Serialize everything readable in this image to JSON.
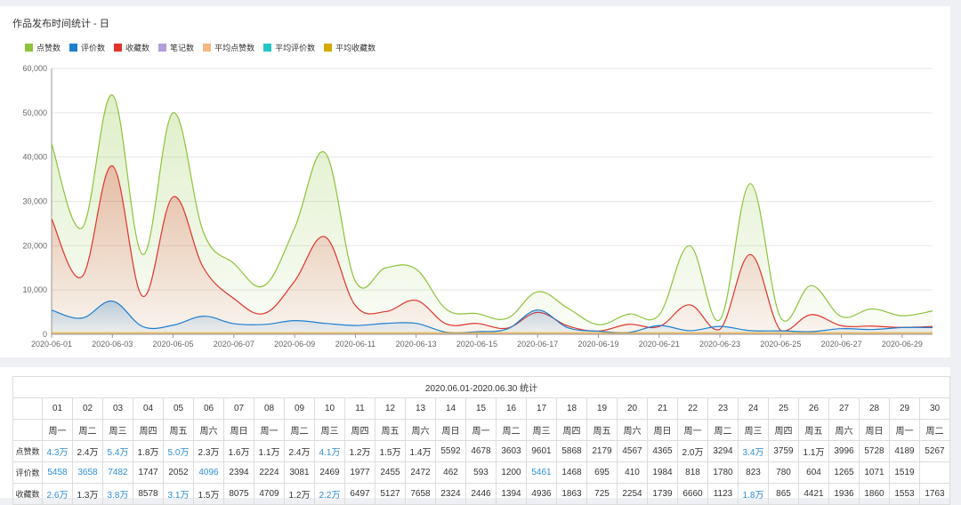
{
  "chart_data": {
    "type": "area",
    "title": "作品发布时间统计 - 日",
    "ylim": [
      0,
      60000
    ],
    "yticks": [
      "0",
      "10,000",
      "20,000",
      "30,000",
      "40,000",
      "50,000",
      "60,000"
    ],
    "ytick_values": [
      0,
      10000,
      20000,
      30000,
      40000,
      50000,
      60000
    ],
    "x": [
      "2020-06-01",
      "2020-06-02",
      "2020-06-03",
      "2020-06-04",
      "2020-06-05",
      "2020-06-06",
      "2020-06-07",
      "2020-06-08",
      "2020-06-09",
      "2020-06-10",
      "2020-06-11",
      "2020-06-12",
      "2020-06-13",
      "2020-06-14",
      "2020-06-15",
      "2020-06-16",
      "2020-06-17",
      "2020-06-18",
      "2020-06-19",
      "2020-06-20",
      "2020-06-21",
      "2020-06-22",
      "2020-06-23",
      "2020-06-24",
      "2020-06-25",
      "2020-06-26",
      "2020-06-27",
      "2020-06-28",
      "2020-06-29",
      "2020-06-30"
    ],
    "xtick_labels": [
      "2020-06-01",
      "2020-06-03",
      "2020-06-05",
      "2020-06-07",
      "2020-06-09",
      "2020-06-11",
      "2020-06-13",
      "2020-06-15",
      "2020-06-17",
      "2020-06-19",
      "2020-06-21",
      "2020-06-23",
      "2020-06-25",
      "2020-06-27",
      "2020-06-29"
    ],
    "grid": true,
    "legend_position": "top-left",
    "series": [
      {
        "name": "点赞数",
        "color": "#8cc43a",
        "values": [
          43000,
          24000,
          54000,
          18000,
          50000,
          23000,
          16000,
          11000,
          24000,
          41000,
          12000,
          15000,
          14700,
          5592,
          4678,
          3603,
          9601,
          5868,
          2179,
          4567,
          4365,
          20000,
          3294,
          34000,
          3759,
          11000,
          3996,
          5728,
          4189,
          5267
        ]
      },
      {
        "name": "评价数",
        "color": "#1f7fcf",
        "values": [
          5458,
          3658,
          7482,
          1747,
          2052,
          4096,
          2394,
          2224,
          3081,
          2469,
          1977,
          2455,
          2472,
          462,
          593,
          1200,
          5461,
          1468,
          695,
          410,
          1984,
          818,
          1780,
          823,
          780,
          604,
          1265,
          1071,
          1519,
          1519
        ]
      },
      {
        "name": "收藏数",
        "color": "#e0332b",
        "values": [
          26000,
          13000,
          38000,
          8578,
          31000,
          15000,
          8075,
          4709,
          12000,
          22000,
          6497,
          5127,
          7658,
          2324,
          2446,
          1394,
          4936,
          1863,
          725,
          2254,
          1739,
          6660,
          1123,
          18000,
          865,
          4421,
          1936,
          1860,
          1553,
          1763
        ]
      },
      {
        "name": "笔记数",
        "color": "#b39ddb",
        "values": []
      },
      {
        "name": "平均点赞数",
        "color": "#f5b783",
        "values": []
      },
      {
        "name": "平均评价数",
        "color": "#26c6c6",
        "values": []
      },
      {
        "name": "平均收藏数",
        "color": "#d4aa00",
        "values": []
      }
    ]
  },
  "table": {
    "caption": "2020.06.01-2020.06.30 统计",
    "days": [
      "01",
      "02",
      "03",
      "04",
      "05",
      "06",
      "07",
      "08",
      "09",
      "10",
      "11",
      "12",
      "13",
      "14",
      "15",
      "16",
      "17",
      "18",
      "19",
      "20",
      "21",
      "22",
      "23",
      "24",
      "25",
      "26",
      "27",
      "28",
      "29",
      "30"
    ],
    "weekdays": [
      "周一",
      "周二",
      "周三",
      "周四",
      "周五",
      "周六",
      "周日",
      "周一",
      "周二",
      "周三",
      "周四",
      "周五",
      "周六",
      "周日",
      "周一",
      "周二",
      "周三",
      "周四",
      "周五",
      "周六",
      "周日",
      "周一",
      "周二",
      "周三",
      "周四",
      "周五",
      "周六",
      "周日",
      "周一",
      "周二"
    ],
    "rows": [
      {
        "label": "点赞数",
        "values": [
          "4.3万",
          "2.4万",
          "5.4万",
          "1.8万",
          "5.0万",
          "2.3万",
          "1.6万",
          "1.1万",
          "2.4万",
          "4.1万",
          "1.2万",
          "1.5万",
          "1.4万",
          "5592",
          "4678",
          "3603",
          "9601",
          "5868",
          "2179",
          "4567",
          "4365",
          "2.0万",
          "3294",
          "3.4万",
          "3759",
          "1.1万",
          "3996",
          "5728",
          "4189",
          "5267"
        ],
        "links": [
          0,
          2,
          4,
          9,
          23
        ]
      },
      {
        "label": "评价数",
        "values": [
          "5458",
          "3658",
          "7482",
          "1747",
          "2052",
          "4096",
          "2394",
          "2224",
          "3081",
          "2469",
          "1977",
          "2455",
          "2472",
          "462",
          "593",
          "1200",
          "5461",
          "1468",
          "695",
          "410",
          "1984",
          "818",
          "1780",
          "823",
          "780",
          "604",
          "1265",
          "1071",
          "1519",
          ""
        ],
        "links": [
          0,
          1,
          2,
          5,
          16
        ]
      },
      {
        "label": "收藏数",
        "values": [
          "2.6万",
          "1.3万",
          "3.8万",
          "8578",
          "3.1万",
          "1.5万",
          "8075",
          "4709",
          "1.2万",
          "2.2万",
          "6497",
          "5127",
          "7658",
          "2324",
          "2446",
          "1394",
          "4936",
          "1863",
          "725",
          "2254",
          "1739",
          "6660",
          "1123",
          "1.8万",
          "865",
          "4421",
          "1936",
          "1860",
          "1553",
          "1763"
        ],
        "links": [
          0,
          2,
          4,
          9,
          23
        ]
      }
    ]
  }
}
